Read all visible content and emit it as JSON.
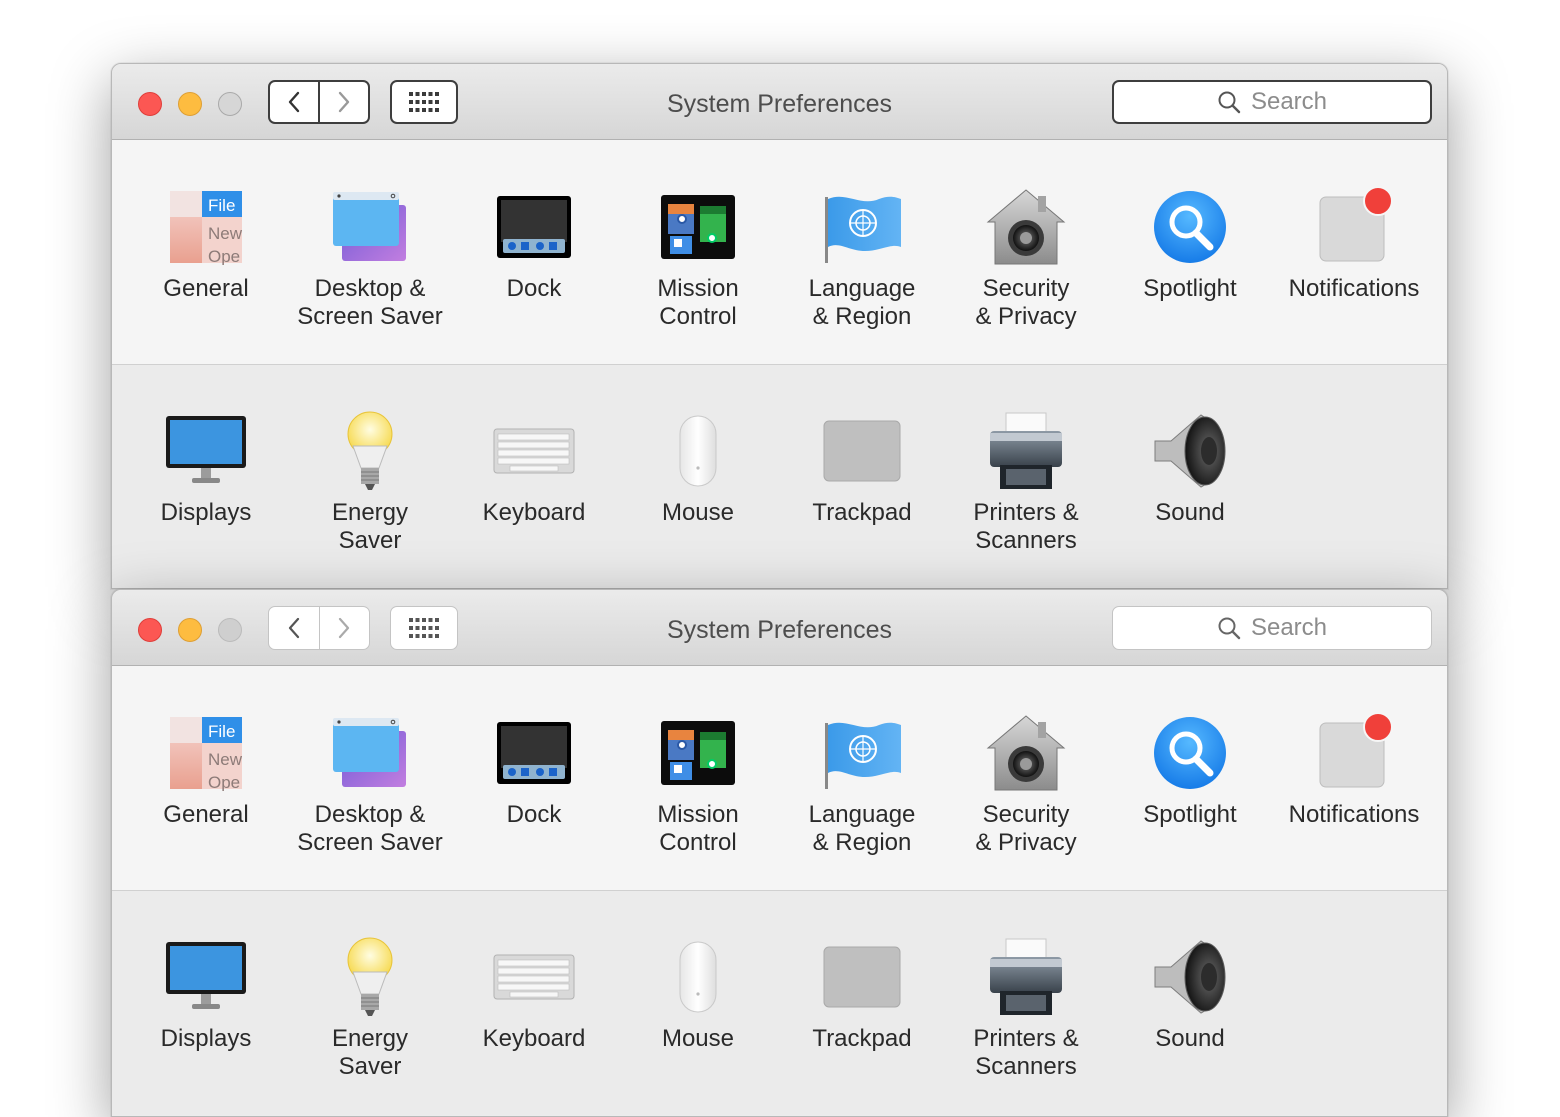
{
  "windows": [
    {
      "title": "System Preferences",
      "search_placeholder": "Search",
      "row1": [
        {
          "label": "General",
          "icon": "general-icon"
        },
        {
          "label": "Desktop &\nScreen Saver",
          "icon": "desktop-screensaver-icon"
        },
        {
          "label": "Dock",
          "icon": "dock-icon"
        },
        {
          "label": "Mission\nControl",
          "icon": "mission-control-icon"
        },
        {
          "label": "Language\n& Region",
          "icon": "language-region-icon"
        },
        {
          "label": "Security\n& Privacy",
          "icon": "security-privacy-icon"
        },
        {
          "label": "Spotlight",
          "icon": "spotlight-icon"
        },
        {
          "label": "Notifications",
          "icon": "notifications-icon"
        }
      ],
      "row2": [
        {
          "label": "Displays",
          "icon": "displays-icon"
        },
        {
          "label": "Energy\nSaver",
          "icon": "energy-saver-icon"
        },
        {
          "label": "Keyboard",
          "icon": "keyboard-icon"
        },
        {
          "label": "Mouse",
          "icon": "mouse-icon"
        },
        {
          "label": "Trackpad",
          "icon": "trackpad-icon"
        },
        {
          "label": "Printers &\nScanners",
          "icon": "printers-scanners-icon"
        },
        {
          "label": "Sound",
          "icon": "sound-icon"
        }
      ]
    },
    {
      "title": "System Preferences",
      "search_placeholder": "Search",
      "row1": [
        {
          "label": "General",
          "icon": "general-icon"
        },
        {
          "label": "Desktop &\nScreen Saver",
          "icon": "desktop-screensaver-icon"
        },
        {
          "label": "Dock",
          "icon": "dock-icon"
        },
        {
          "label": "Mission\nControl",
          "icon": "mission-control-icon"
        },
        {
          "label": "Language\n& Region",
          "icon": "language-region-icon"
        },
        {
          "label": "Security\n& Privacy",
          "icon": "security-privacy-icon"
        },
        {
          "label": "Spotlight",
          "icon": "spotlight-icon"
        },
        {
          "label": "Notifications",
          "icon": "notifications-icon"
        }
      ],
      "row2": [
        {
          "label": "Displays",
          "icon": "displays-icon"
        },
        {
          "label": "Energy\nSaver",
          "icon": "energy-saver-icon"
        },
        {
          "label": "Keyboard",
          "icon": "keyboard-icon"
        },
        {
          "label": "Mouse",
          "icon": "mouse-icon"
        },
        {
          "label": "Trackpad",
          "icon": "trackpad-icon"
        },
        {
          "label": "Printers &\nScanners",
          "icon": "printers-scanners-icon"
        },
        {
          "label": "Sound",
          "icon": "sound-icon"
        }
      ]
    }
  ],
  "colors": {
    "close": "#fc5753",
    "minimize": "#fdbc40",
    "zoom_inactive": "#d6d6d6",
    "badge": "#f0403a",
    "spotlight_blue": "#1b8ff0"
  }
}
